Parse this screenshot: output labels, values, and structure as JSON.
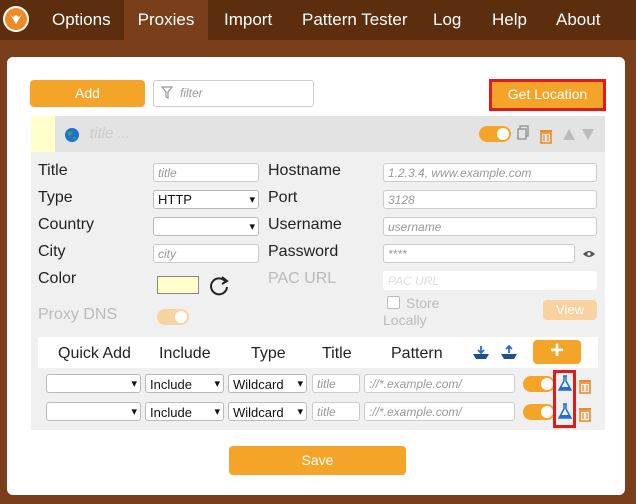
{
  "nav": {
    "tabs": [
      "Options",
      "Proxies",
      "Import",
      "Pattern Tester",
      "Log",
      "Help",
      "About"
    ],
    "active": "Proxies"
  },
  "toolbar": {
    "add_label": "Add",
    "filter_placeholder": "filter",
    "get_location_label": "Get Location"
  },
  "proxy": {
    "title_placeholder": "title ...",
    "form": {
      "title_label": "Title",
      "title_placeholder": "title",
      "type_label": "Type",
      "type_value": "HTTP",
      "country_label": "Country",
      "country_value": "",
      "city_label": "City",
      "city_placeholder": "city",
      "color_label": "Color",
      "color_value": "#ffffcc",
      "proxy_dns_label": "Proxy DNS",
      "hostname_label": "Hostname",
      "hostname_placeholder": "1.2.3.4, www.example.com",
      "port_label": "Port",
      "port_placeholder": "3128",
      "username_label": "Username",
      "username_placeholder": "username",
      "password_label": "Password",
      "password_placeholder": "****",
      "pac_url_label": "PAC URL",
      "pac_url_placeholder": "PAC URL",
      "store_locally_label_1": "Store",
      "store_locally_label_2": "Locally",
      "view_label": "View"
    },
    "patterns": {
      "headers": [
        "Quick Add",
        "Include",
        "Type",
        "Title",
        "Pattern"
      ],
      "add_label": "+",
      "rows": [
        {
          "quick_add": "",
          "include": "Include",
          "type": "Wildcard",
          "title_placeholder": "title",
          "pattern_placeholder": "://*.example.com/"
        },
        {
          "quick_add": "",
          "include": "Include",
          "type": "Wildcard",
          "title_placeholder": "title",
          "pattern_placeholder": "://*.example.com/"
        }
      ]
    }
  },
  "save_label": "Save",
  "colors": {
    "accent": "#f5a42a",
    "nav_bg": "#5c2e0e",
    "page_bg": "#7a3f1a",
    "highlight": "#e21a1a"
  }
}
